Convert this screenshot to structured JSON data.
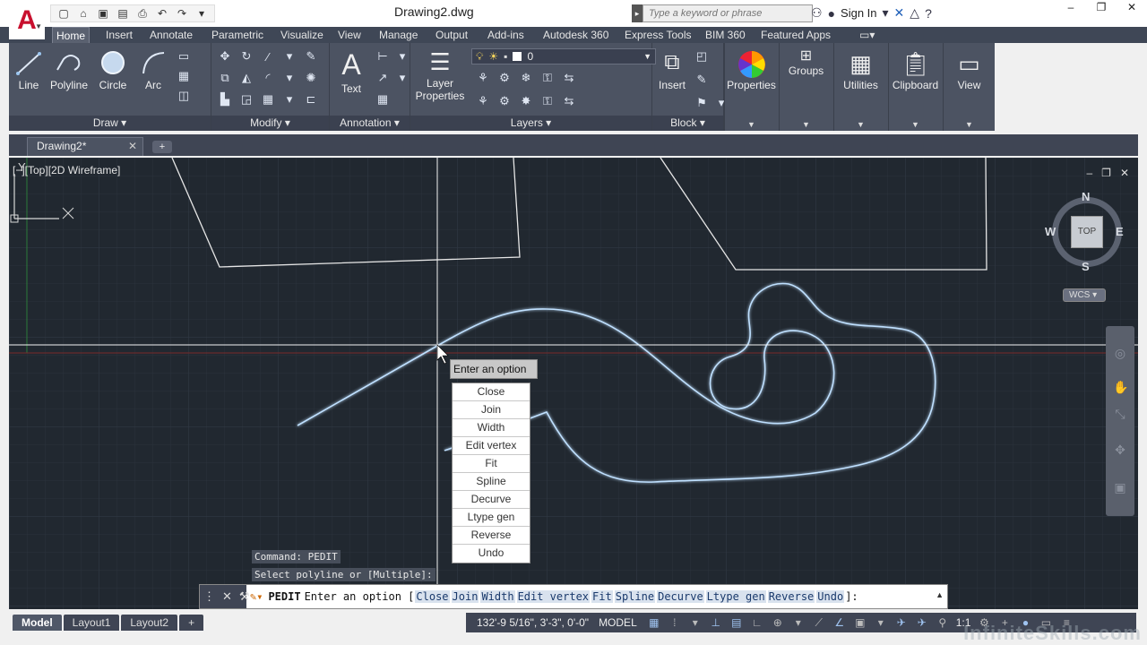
{
  "title_bar": {
    "document_title": "Drawing2.dwg",
    "search_placeholder": "Type a keyword or phrase",
    "sign_in": "Sign In"
  },
  "ribbon_tabs": [
    "Home",
    "Insert",
    "Annotate",
    "Parametric",
    "Visualize",
    "View",
    "Manage",
    "Output",
    "Add-ins",
    "Autodesk 360",
    "Express Tools",
    "BIM 360",
    "Featured Apps"
  ],
  "active_ribbon_tab": "Home",
  "panels": {
    "draw": {
      "title": "Draw",
      "tools": [
        "Line",
        "Polyline",
        "Circle",
        "Arc"
      ]
    },
    "modify": {
      "title": "Modify"
    },
    "annotation": {
      "title": "Annotation",
      "text_tool": "Text"
    },
    "layers": {
      "title": "Layers",
      "layer_properties_line1": "Layer",
      "layer_properties_line2": "Properties",
      "current_layer": "0"
    },
    "block": {
      "title": "Block",
      "insert_tool": "Insert"
    },
    "properties": "Properties",
    "groups": "Groups",
    "utilities": "Utilities",
    "clipboard": "Clipboard",
    "view": "View"
  },
  "file_tab": {
    "label": "Drawing2*"
  },
  "viewport": {
    "label": "[−][Top][2D Wireframe]",
    "viewcube_face": "TOP",
    "compass": {
      "n": "N",
      "s": "S",
      "e": "E",
      "w": "W"
    },
    "ucs_label": "WCS",
    "ucs_axis_y": "Y"
  },
  "dynamic_input": {
    "prompt": "Enter an option",
    "options": [
      "Close",
      "Join",
      "Width",
      "Edit vertex",
      "Fit",
      "Spline",
      "Decurve",
      "Ltype gen",
      "Reverse",
      "Undo"
    ]
  },
  "command_history": [
    "Command: PEDIT",
    "Select polyline or [Multiple]:"
  ],
  "command_line": {
    "command": "PEDIT",
    "prompt": "Enter an option [",
    "options": [
      "Close",
      "Join",
      "Width",
      "Edit vertex",
      "Fit",
      "Spline",
      "Decurve",
      "Ltype gen",
      "Reverse",
      "Undo"
    ],
    "suffix": "]:"
  },
  "layout_tabs": [
    "Model",
    "Layout1",
    "Layout2"
  ],
  "active_layout": "Model",
  "status_bar": {
    "coordinates": "132'-9 5/16\", 3'-3\", 0'-0\"",
    "space": "MODEL",
    "scale": "1:1"
  },
  "watermark": "InfiniteSkills.com",
  "colors": {
    "canvas_bg": "#212830",
    "ribbon_bg": "#4c5362",
    "polyline_highlight": "#bfe0ff",
    "crosshair": "#ffffff"
  }
}
